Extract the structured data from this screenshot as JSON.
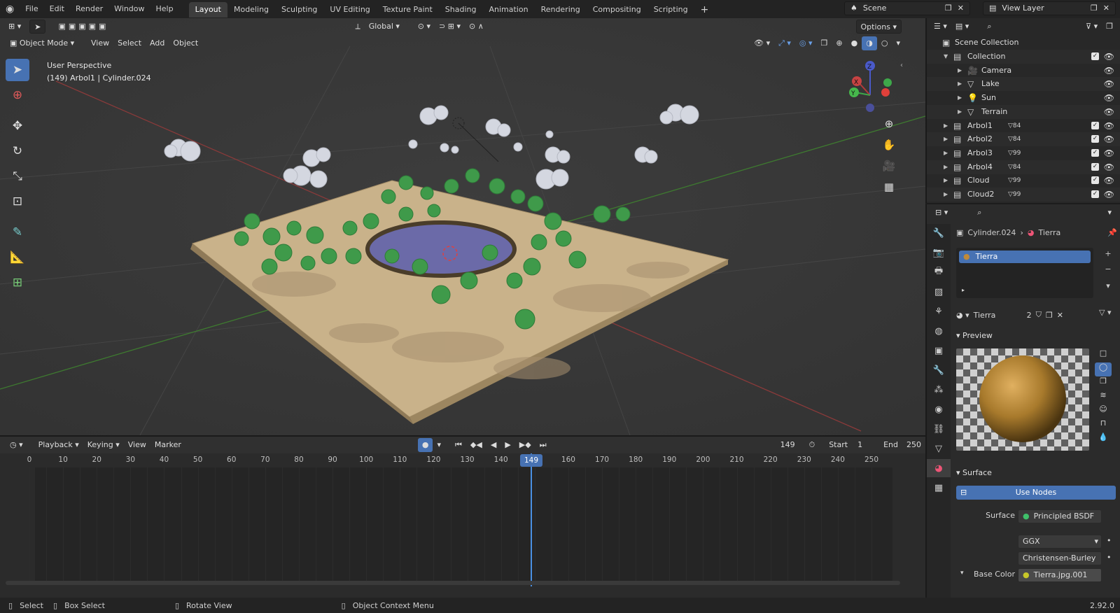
{
  "topbar": {
    "menus": [
      "File",
      "Edit",
      "Render",
      "Window",
      "Help"
    ],
    "workspaces": [
      "Layout",
      "Modeling",
      "Sculpting",
      "UV Editing",
      "Texture Paint",
      "Shading",
      "Animation",
      "Rendering",
      "Compositing",
      "Scripting"
    ],
    "active_workspace": "Layout",
    "add_workspace": "+",
    "scene_label": "Scene",
    "view_layer_label": "View Layer"
  },
  "viewport": {
    "transform_orientation": "Global",
    "options_label": "Options",
    "mode_label": "Object Mode",
    "menus": [
      "View",
      "Select",
      "Add",
      "Object"
    ],
    "perspective_label": "User Perspective",
    "object_info": "(149) Arbol1 | Cylinder.024",
    "gizmo_axes": [
      "Z",
      "X",
      "Y"
    ]
  },
  "timeline": {
    "menus": [
      "Playback",
      "Keying",
      "View",
      "Marker"
    ],
    "current_frame": "149",
    "start_label": "Start",
    "start_value": "1",
    "end_label": "End",
    "end_value": "250",
    "ticks": [
      "0",
      "10",
      "20",
      "30",
      "40",
      "50",
      "60",
      "70",
      "80",
      "90",
      "100",
      "110",
      "120",
      "130",
      "140",
      "149",
      "160",
      "170",
      "180",
      "190",
      "200",
      "210",
      "220",
      "230",
      "240",
      "250"
    ],
    "playhead_label": "149",
    "playhead_frame": 149
  },
  "statusbar": {
    "select": "Select",
    "box_select": "Box Select",
    "rotate_view": "Rotate View",
    "context_menu": "Object Context Menu",
    "version": "2.92.0"
  },
  "outliner": {
    "root": "Scene Collection",
    "rows": [
      {
        "label": "Collection",
        "level": 1,
        "icon": "collection-icon",
        "checked": true
      },
      {
        "label": "Camera",
        "level": 2,
        "icon": "camera-icon",
        "checked": false
      },
      {
        "label": "Lake",
        "level": 2,
        "icon": "mesh-icon",
        "checked": false
      },
      {
        "label": "Sun",
        "level": 2,
        "icon": "light-icon",
        "checked": false
      },
      {
        "label": "Terrain",
        "level": 2,
        "icon": "mesh-icon",
        "checked": false
      },
      {
        "label": "Arbol1",
        "level": 1,
        "icon": "collection-icon",
        "checked": true,
        "count": "84"
      },
      {
        "label": "Arbol2",
        "level": 1,
        "icon": "collection-icon",
        "checked": true,
        "count": "84"
      },
      {
        "label": "Arbol3",
        "level": 1,
        "icon": "collection-icon",
        "checked": true,
        "count": "99"
      },
      {
        "label": "Arbol4",
        "level": 1,
        "icon": "collection-icon",
        "checked": true,
        "count": "84"
      },
      {
        "label": "Cloud",
        "level": 1,
        "icon": "collection-icon",
        "checked": true,
        "count": "99"
      },
      {
        "label": "Cloud2",
        "level": 1,
        "icon": "collection-icon",
        "checked": true,
        "count": "99"
      }
    ]
  },
  "properties": {
    "object_name": "Cylinder.024",
    "material_name": "Tierra",
    "slot_name": "Tierra",
    "material_users": "2",
    "preview_label": "Preview",
    "surface_section": "Surface",
    "use_nodes": "Use Nodes",
    "surface_label": "Surface",
    "surface_value": "Principled BSDF",
    "distribution": "GGX",
    "subsurface_method": "Christensen-Burley",
    "base_color_label": "Base Color",
    "base_color_value": "Tierra.jpg.001"
  }
}
